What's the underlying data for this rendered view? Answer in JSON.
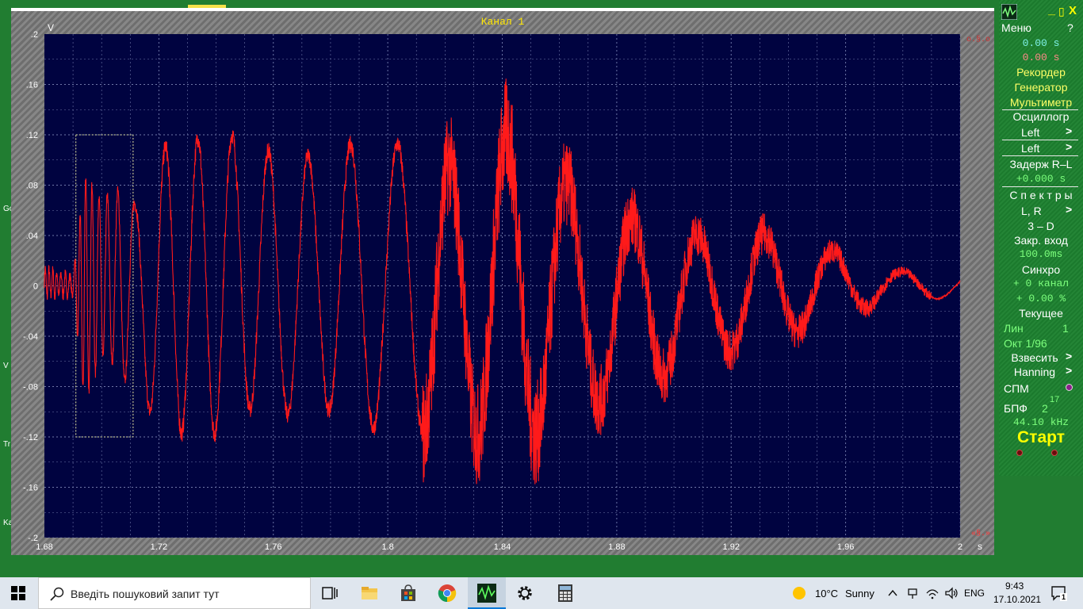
{
  "window": {
    "title": "Канал 1"
  },
  "chart_data": {
    "type": "line",
    "title": "Канал 1",
    "xlabel": "s",
    "ylabel": "V",
    "xlim": [
      1.68,
      2.0
    ],
    "ylim": [
      -0.2,
      0.2
    ],
    "x_ticks": [
      "1.68",
      "1.72",
      "1.76",
      "1.8",
      "1.84",
      "1.88",
      "1.92",
      "1.96",
      "2"
    ],
    "y_ticks": [
      ".2",
      ".16",
      ".12",
      ".08",
      ".04",
      "0",
      "-.04",
      "-.08",
      "-.12",
      "-.16",
      "-.2"
    ],
    "grid": true,
    "corner_top_right": "o.§.o",
    "corner_bottom_right": "«§.»",
    "selection_box": {
      "x": [
        1.691,
        1.711
      ],
      "y": [
        -0.12,
        0.12
      ]
    },
    "series": [
      {
        "color": "#ff1a1a",
        "envelope": [
          {
            "x": 1.68,
            "min": -0.01,
            "max": 0.015
          },
          {
            "x": 1.69,
            "min": -0.008,
            "max": 0.008
          },
          {
            "x": 1.694,
            "min": -0.1,
            "max": 0.095
          },
          {
            "x": 1.7,
            "min": -0.06,
            "max": 0.075
          },
          {
            "x": 1.706,
            "min": -0.07,
            "max": 0.08
          },
          {
            "x": 1.712,
            "min": -0.1,
            "max": 0.07
          },
          {
            "x": 1.72,
            "min": -0.11,
            "max": 0.115
          },
          {
            "x": 1.728,
            "min": -0.125,
            "max": 0.125
          },
          {
            "x": 1.74,
            "min": -0.125,
            "max": 0.125
          },
          {
            "x": 1.752,
            "min": -0.105,
            "max": 0.13
          },
          {
            "x": 1.764,
            "min": -0.11,
            "max": 0.1
          },
          {
            "x": 1.776,
            "min": -0.1,
            "max": 0.115
          },
          {
            "x": 1.788,
            "min": -0.12,
            "max": 0.12
          },
          {
            "x": 1.8,
            "min": -0.12,
            "max": 0.12
          },
          {
            "x": 1.812,
            "min": -0.125,
            "max": 0.12
          },
          {
            "x": 1.824,
            "min": -0.125,
            "max": 0.1
          },
          {
            "x": 1.836,
            "min": -0.125,
            "max": 0.12
          },
          {
            "x": 1.846,
            "min": -0.135,
            "max": 0.135
          },
          {
            "x": 1.858,
            "min": -0.115,
            "max": 0.1
          },
          {
            "x": 1.87,
            "min": -0.1,
            "max": 0.07
          },
          {
            "x": 1.882,
            "min": -0.09,
            "max": 0.06
          },
          {
            "x": 1.894,
            "min": -0.08,
            "max": 0.055
          },
          {
            "x": 1.906,
            "min": -0.06,
            "max": 0.045
          },
          {
            "x": 1.918,
            "min": -0.055,
            "max": 0.04
          },
          {
            "x": 1.93,
            "min": -0.05,
            "max": 0.045
          },
          {
            "x": 1.942,
            "min": -0.04,
            "max": 0.04
          },
          {
            "x": 1.954,
            "min": -0.03,
            "max": 0.03
          },
          {
            "x": 1.966,
            "min": -0.02,
            "max": 0.025
          },
          {
            "x": 1.978,
            "min": -0.012,
            "max": 0.012
          },
          {
            "x": 2.0,
            "min": -0.01,
            "max": 0.01
          }
        ],
        "dominant_frequency_hz": [
          {
            "x": 1.68,
            "f": 800
          },
          {
            "x": 1.712,
            "f": 95
          },
          {
            "x": 1.76,
            "f": 75
          },
          {
            "x": 1.81,
            "f": 55
          },
          {
            "x": 1.86,
            "f": 45
          },
          {
            "x": 1.94,
            "f": 42
          },
          {
            "x": 2.0,
            "f": 40
          }
        ]
      }
    ]
  },
  "panel": {
    "menu": "Меню",
    "help": "?",
    "minimize": "_",
    "maximize": "▯",
    "close": "X",
    "time_cursor_1": "0.00  s",
    "time_cursor_2": "0.00  s",
    "recorder": "Рекордер",
    "generator": "Генератор",
    "multimeter": "Мультиметр",
    "oscilloscope": "Осциллогр",
    "left_1": "Left",
    "left_2": "Left",
    "arrow": ">",
    "delay": "Задерж  R–L",
    "delay_value": "+0.000  s",
    "spectra": "С п е к т р ы",
    "lr": "L, R",
    "three_d": "3 – D",
    "input_close": "Закр. вход",
    "input_value": "100.0ms",
    "sync": "Синхро",
    "sync_channel": "+  0 канал",
    "sync_percent": "+  0.00 %",
    "current": "Текущее",
    "lin": "Лин",
    "lin_value": "1",
    "oct": "Окт  1/96",
    "weight": "Взвесить",
    "window_fn": "Hanning",
    "spm": "СПМ",
    "fft": "БПФ",
    "fft_base": "2",
    "fft_exp": "17",
    "sample_rate": "44.10 kHz",
    "start": "Старт"
  },
  "desktop": {
    "labels": [
      "Go",
      "V",
      "Tr",
      "Ka"
    ]
  },
  "taskbar": {
    "search_placeholder": "Введіть пошуковий запит тут",
    "weather_temp": "10°C",
    "weather_text": "Sunny",
    "language": "ENG",
    "time": "9:43",
    "date": "17.10.2021",
    "notifications_count": "1",
    "colors": {
      "start": "#000000",
      "accent": "#0078d7"
    }
  }
}
